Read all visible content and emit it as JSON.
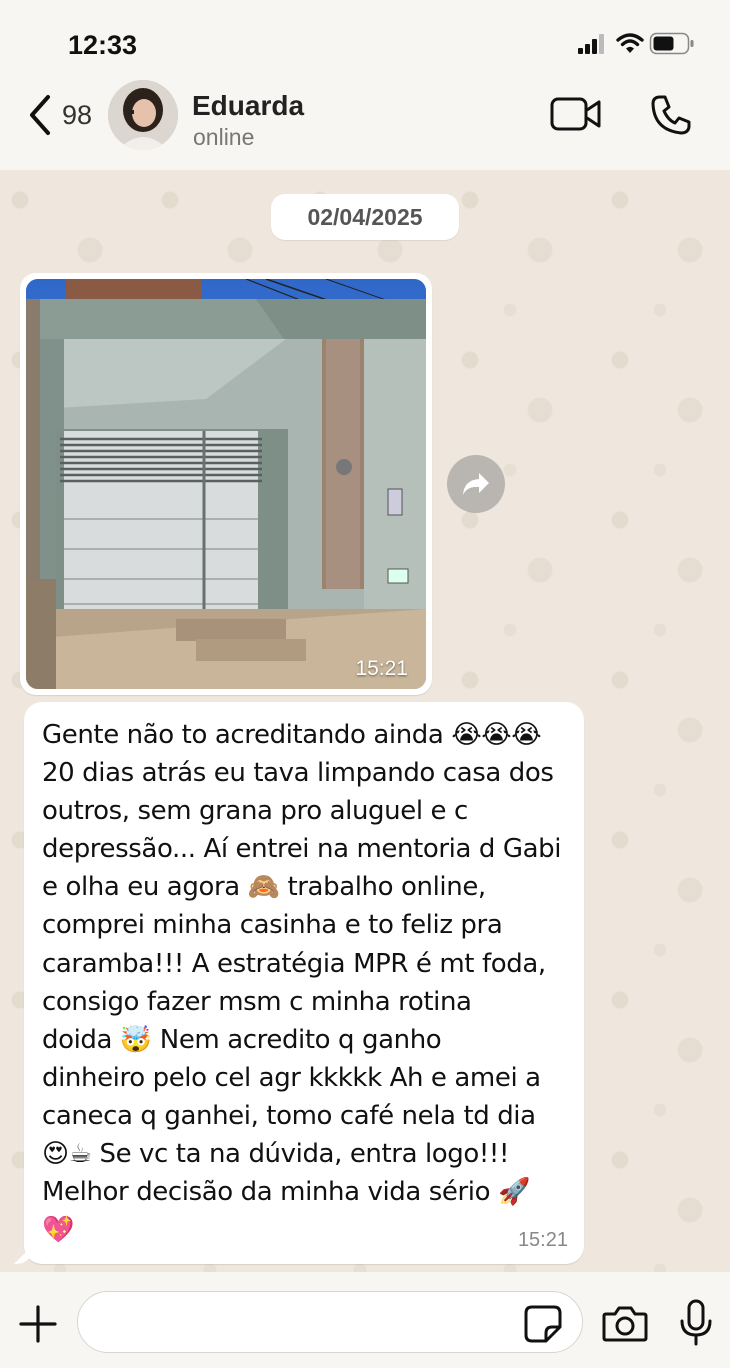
{
  "status_bar": {
    "time": "12:33"
  },
  "header": {
    "back_count": "98",
    "contact_name": "Eduarda",
    "contact_status": "online"
  },
  "chat": {
    "date_label": "02/04/2025",
    "messages": [
      {
        "type": "image",
        "time": "15:21"
      },
      {
        "type": "text",
        "text": "Gente não to acreditando ainda 😭😭😭\n20 dias atrás eu tava limpando casa dos\noutros, sem grana pro aluguel e c\ndepressão... Aí entrei na mentoria d Gabi\ne olha eu agora 🙈 trabalho online,\ncomprei minha casinha e to feliz pra\ncaramba!!! A estratégia MPR é mt foda,\nconsigo fazer msm c minha rotina\ndoida 🤯 Nem acredito q ganho\ndinheiro pelo cel agr kkkkk Ah e amei a\ncaneca q ganhei, tomo café nela td dia\n😍☕ Se vc ta na dúvida, entra logo!!!\nMelhor decisão da minha vida sério 🚀\n💖",
        "time": "15:21"
      }
    ]
  },
  "input_bar": {
    "value": "",
    "placeholder": ""
  },
  "colors": {
    "chat_background": "#efe7dd",
    "bubble": "#ffffff",
    "bar_background": "#f7f6f3"
  }
}
